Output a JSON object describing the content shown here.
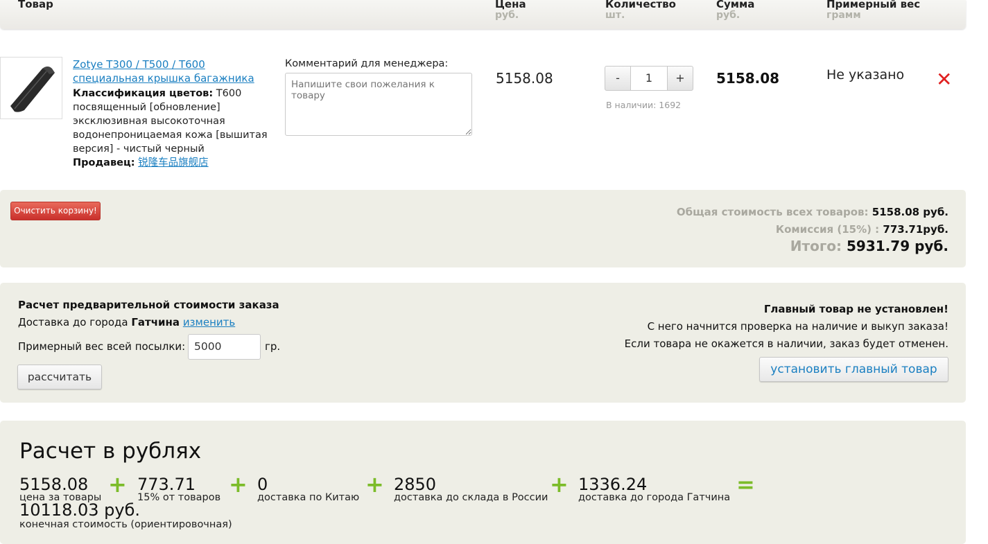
{
  "header": {
    "col_product": "Товар",
    "col_price": "Цена",
    "col_price_unit": "руб.",
    "col_qty": "Количество",
    "col_qty_unit": "шт.",
    "col_sum": "Сумма",
    "col_sum_unit": "руб.",
    "col_weight": "Примерный вес",
    "col_weight_unit": "грамм"
  },
  "item": {
    "name": "Zotye T300 / T500 / T600 специальная крышка багажника",
    "color_label": "Классификация цветов:",
    "color_value": "T600 посвященный [обновление] эксклюзивная высокоточная водонепроницаемая кожа [вышитая версия] - чистый черный",
    "seller_label": "Продавец:",
    "seller_name": "锐隆车品旗舰店",
    "comment_label": "Комментарий для менеджера:",
    "comment_placeholder": "Напишите свои пожелания к товару",
    "price": "5158.08",
    "qty_minus": "-",
    "qty_value": "1",
    "qty_plus": "+",
    "stock": "В наличии: 1692",
    "sum": "5158.08",
    "weight": "Не указано",
    "remove_glyph": "✕"
  },
  "cart": {
    "clear_button": "Очистить корзину!",
    "total_label": "Общая стоимость всех товаров:",
    "total_value": "5158.08 руб.",
    "commission_label": "Комиссия (15%) :",
    "commission_value": "773.71руб.",
    "grand_label": "Итого:",
    "grand_value": "5931.79 руб."
  },
  "calc": {
    "title": "Расчет предварительной стоимости заказа",
    "delivery_prefix": "Доставка до города",
    "city": "Гатчина",
    "change_link": "изменить",
    "weight_label": "Примерный вес всей посылки:",
    "weight_value": "5000",
    "weight_unit": "гр.",
    "calc_button": "рассчитать",
    "main_warning": "Главный товар не установлен!",
    "main_line1": "С него начнится проверка на наличие и выкуп заказа!",
    "main_line2": "Если товара не окажется в наличии, заказ будет отменен.",
    "main_button": "установить главный товар"
  },
  "rub": {
    "title": "Расчет в рублях",
    "terms": [
      {
        "value": "5158.08",
        "caption": "цена за товары"
      },
      {
        "value": "773.71",
        "caption": "15% от товаров"
      },
      {
        "value": "0",
        "caption": "доставка по Китаю"
      },
      {
        "value": "2850",
        "caption": "доставка до склада в России"
      },
      {
        "value": "1336.24",
        "caption": "доставка до города Гатчина"
      }
    ],
    "plus": "+",
    "equals": "=",
    "final_value": "10118.03 руб.",
    "final_caption": "конечная стоимость (ориентировочная)"
  },
  "colors": {
    "link": "#1a7fc1",
    "panel_bg": "#eeeee6",
    "accent_green": "#7cbc2a",
    "remove_red": "#e02020",
    "clear_button": "#d9433a"
  }
}
